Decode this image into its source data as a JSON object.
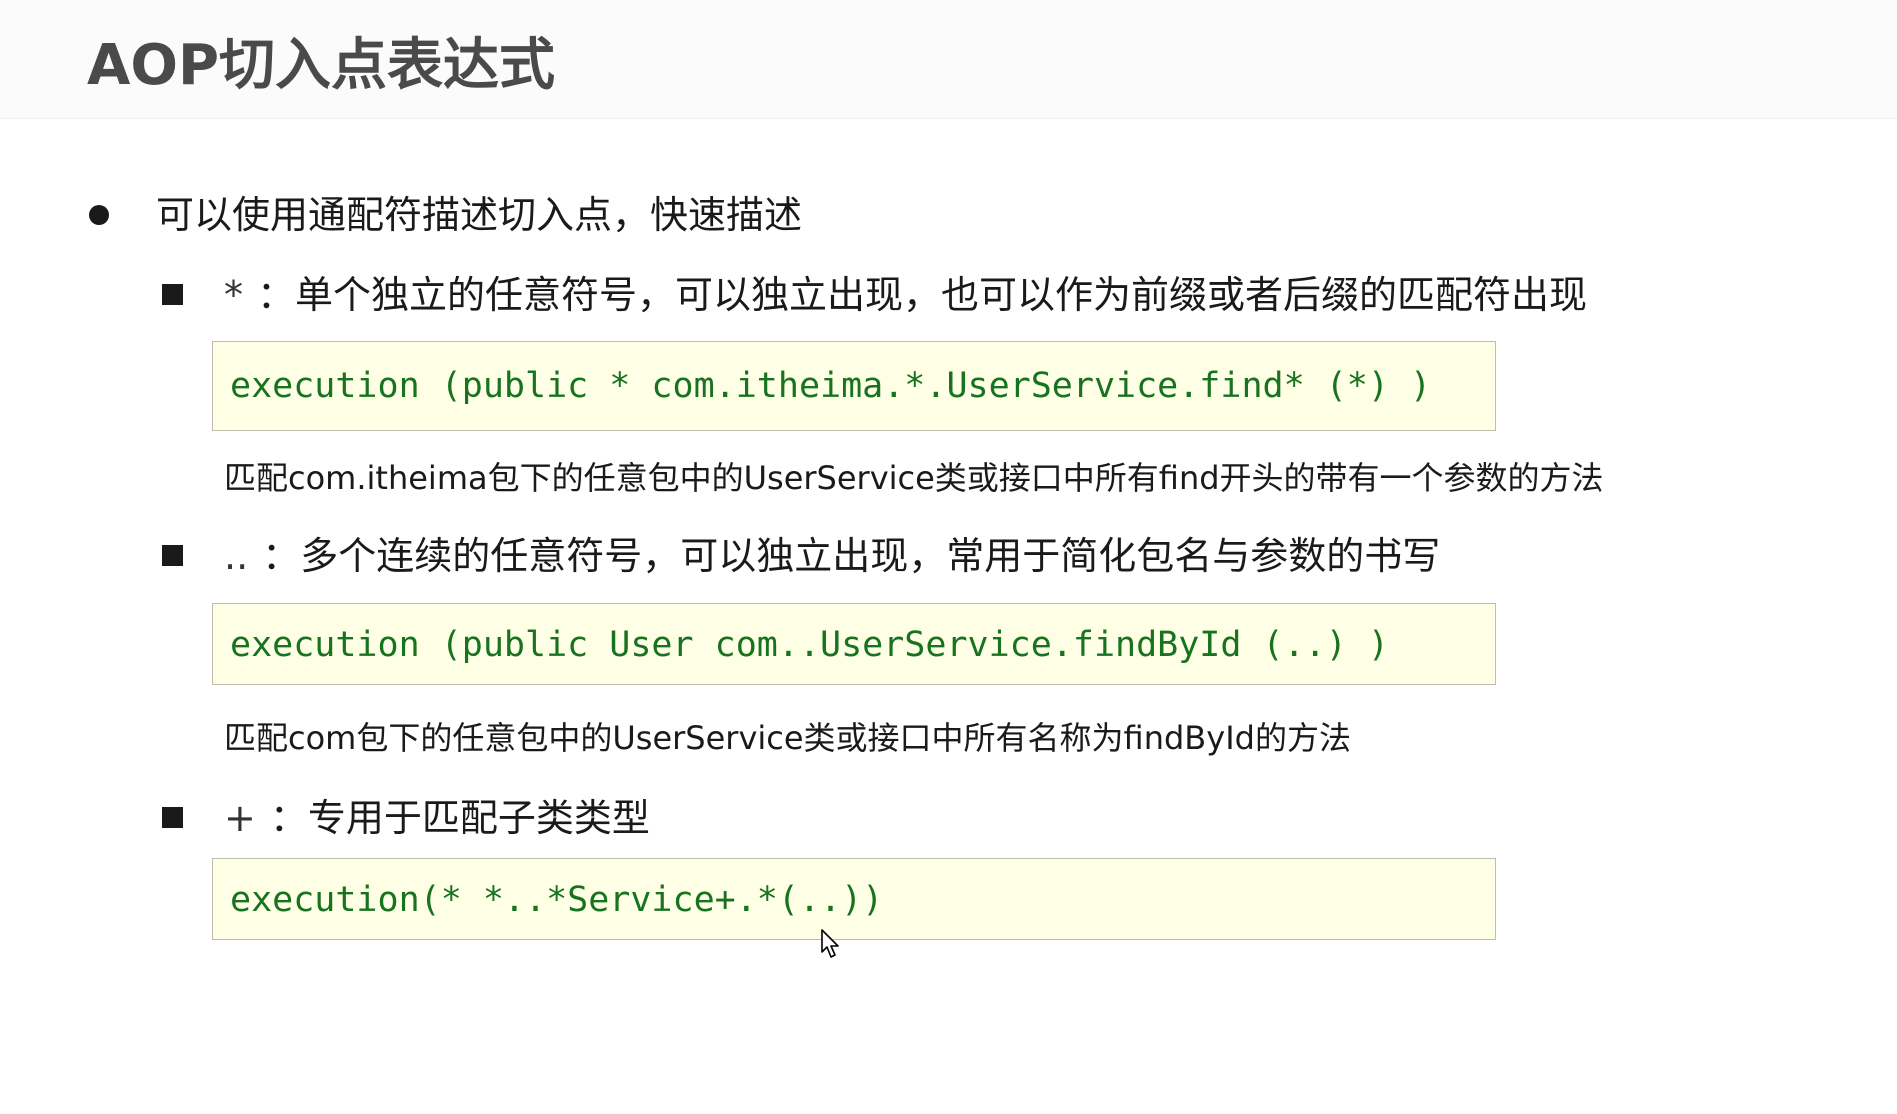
{
  "title": "AOP切入点表达式",
  "intro": "可以使用通配符描述切入点，快速描述",
  "wildcards": [
    {
      "symbol": "*",
      "sep": "：",
      "description": "单个独立的任意符号，可以独立出现，也可以作为前缀或者后缀的匹配符出现",
      "code": "execution (public * com.itheima.*.UserService.find* (*) )",
      "explanation": "匹配com.itheima包下的任意包中的UserService类或接口中所有find开头的带有一个参数的方法"
    },
    {
      "symbol": "..",
      "sep": "：",
      "description": "多个连续的任意符号，可以独立出现，常用于简化包名与参数的书写",
      "code": "execution (public User com..UserService.findById (..) )",
      "explanation": "匹配com包下的任意包中的UserService类或接口中所有名称为findById的方法"
    },
    {
      "symbol": "+",
      "sep": "：",
      "description": "专用于匹配子类类型",
      "code": "execution(* *..*Service+.*(..))",
      "explanation": ""
    }
  ],
  "colors": {
    "code_text": "#17731f",
    "code_background": "#ffffe6",
    "title": "#4a4a4a"
  },
  "icons": {
    "bullet": "filled-circle",
    "sub_bullet": "filled-square",
    "pointer": "mouse-cursor-arrow"
  }
}
